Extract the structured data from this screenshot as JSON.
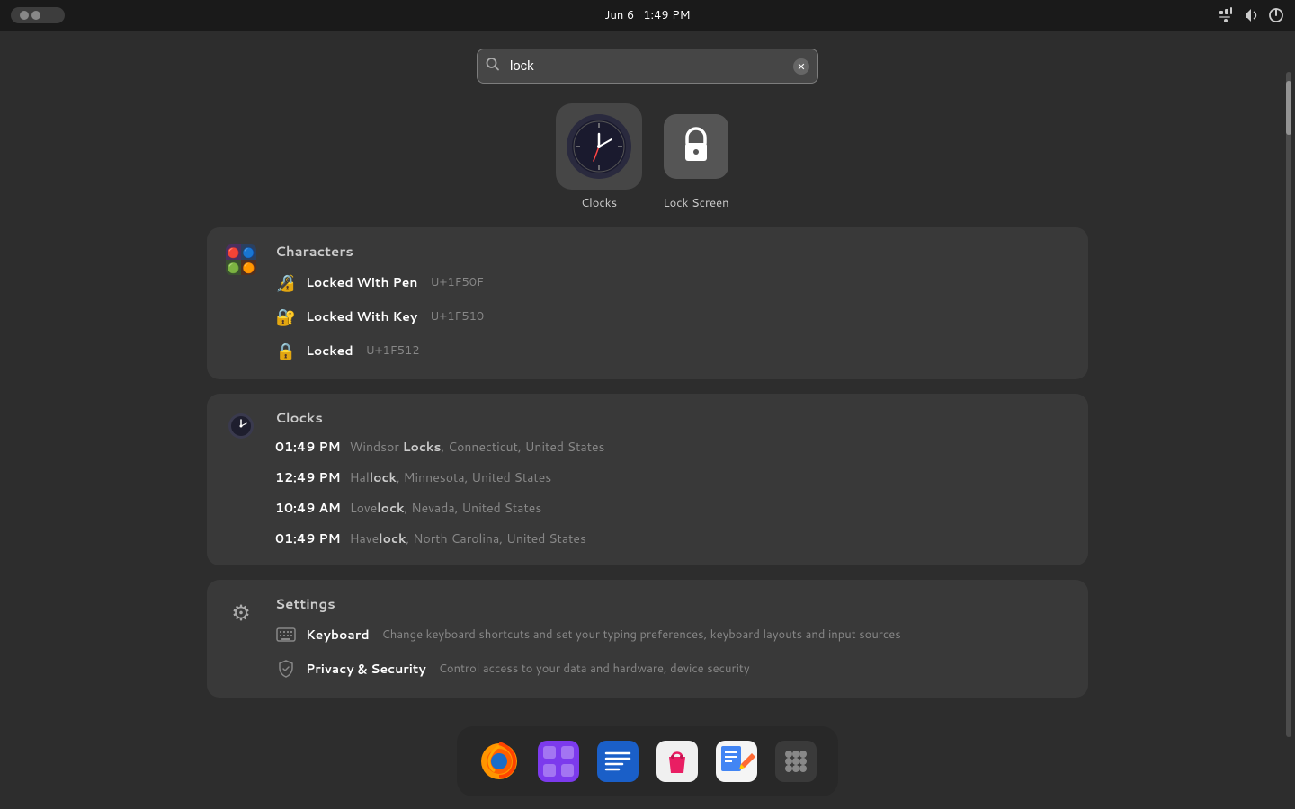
{
  "topbar": {
    "date": "Jun 6",
    "time": "1:49 PM"
  },
  "search": {
    "value": "lock",
    "placeholder": "lock"
  },
  "appIcons": [
    {
      "id": "clocks",
      "label": "Clocks",
      "type": "clock",
      "active": true
    },
    {
      "id": "lockscreen",
      "label": "Lock Screen",
      "type": "lock",
      "active": false
    }
  ],
  "sections": [
    {
      "id": "characters",
      "title": "Characters",
      "icon": "characters",
      "items": [
        {
          "emoji": "🔏",
          "name": "Locked With Pen",
          "code": "U+1F50F"
        },
        {
          "emoji": "🔐",
          "name": "Locked With Key",
          "code": "U+1F510"
        },
        {
          "emoji": "🔒",
          "name": "Locked",
          "code": "U+1F512"
        }
      ]
    },
    {
      "id": "clocks",
      "title": "Clocks",
      "icon": "clock",
      "items": [
        {
          "time": "01:49 PM",
          "location": "Windsor Locks, Connecticut, United States",
          "bold": "Locks"
        },
        {
          "time": "12:49 PM",
          "location": "Hallock, Minnesota, United States",
          "bold": "lock"
        },
        {
          "time": "10:49 AM",
          "location": "Lovelock, Nevada, United States",
          "bold": "lock"
        },
        {
          "time": "01:49 PM",
          "location": "Havelock, North Carolina, United States",
          "bold": "lock"
        }
      ]
    },
    {
      "id": "settings",
      "title": "Settings",
      "icon": "gear",
      "items": [
        {
          "icon": "keyboard",
          "name": "Keyboard",
          "desc": "Change keyboard shortcuts and set your typing preferences, keyboard layouts and input sources"
        },
        {
          "icon": "hand",
          "name": "Privacy & Security",
          "desc": "Control access to your data and hardware, device security"
        }
      ]
    }
  ],
  "dock": {
    "apps": [
      {
        "id": "firefox",
        "label": "Firefox",
        "type": "firefox"
      },
      {
        "id": "software",
        "label": "Software",
        "type": "software"
      },
      {
        "id": "notes",
        "label": "Notes",
        "type": "notes"
      },
      {
        "id": "flatseal",
        "label": "Flatseal",
        "type": "flatseal"
      },
      {
        "id": "writer",
        "label": "Writer",
        "type": "writer"
      },
      {
        "id": "apps",
        "label": "Apps",
        "type": "grid"
      }
    ]
  }
}
